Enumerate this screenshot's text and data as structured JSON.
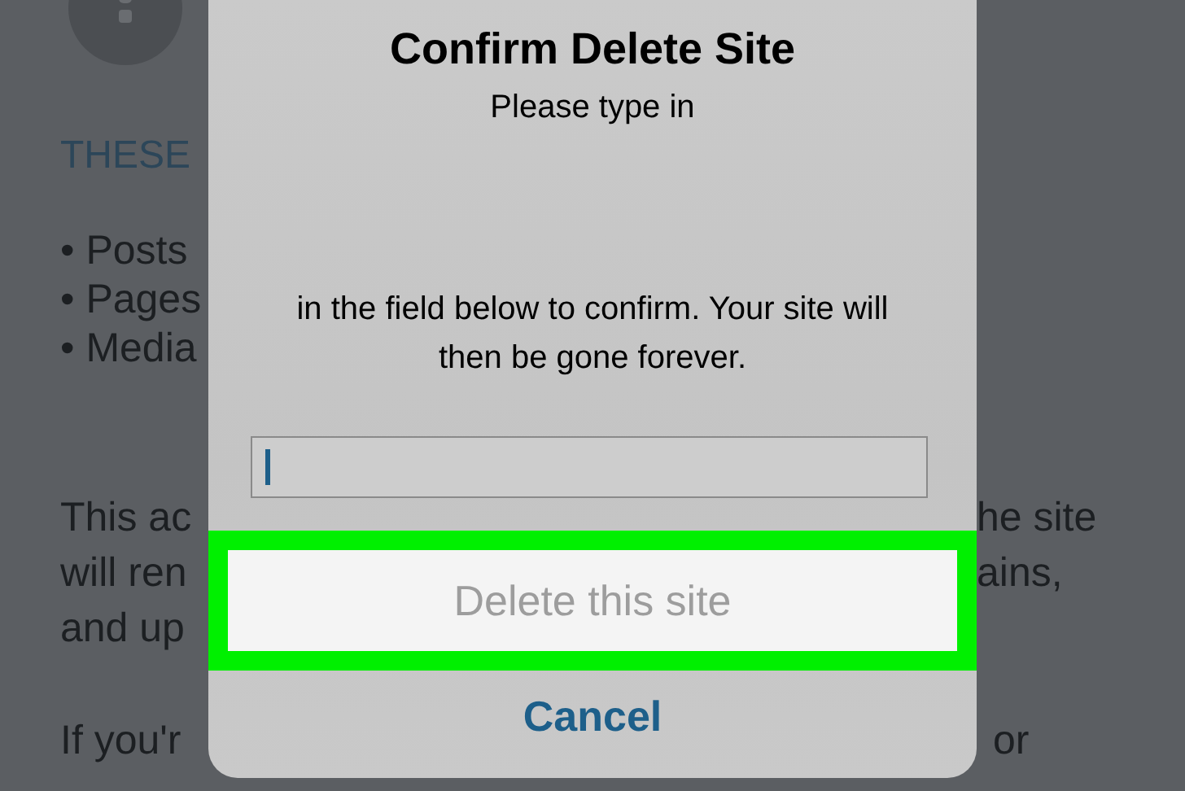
{
  "background_page": {
    "left": {
      "heading": "THESE",
      "bullets": [
        "• Posts",
        "• Pages",
        "• Media"
      ],
      "paragraph_1": [
        "This ac",
        "will ren",
        "and up"
      ],
      "paragraph_2": "If you'r"
    },
    "right": {
      "paragraph_1": [
        "he site",
        "ains,"
      ],
      "paragraph_2": "or"
    }
  },
  "dialog": {
    "title": "Confirm Delete Site",
    "message_1": "Please type in",
    "message_2": "in the field below to confirm. Your site will then be gone forever.",
    "input": {
      "focused": true
    },
    "buttons": [
      {
        "kind": "primary",
        "label": "Delete this site",
        "disabled": true,
        "highlighted": true
      },
      {
        "kind": "cancel",
        "label": "Cancel",
        "disabled": false,
        "highlighted": false
      }
    ]
  }
}
